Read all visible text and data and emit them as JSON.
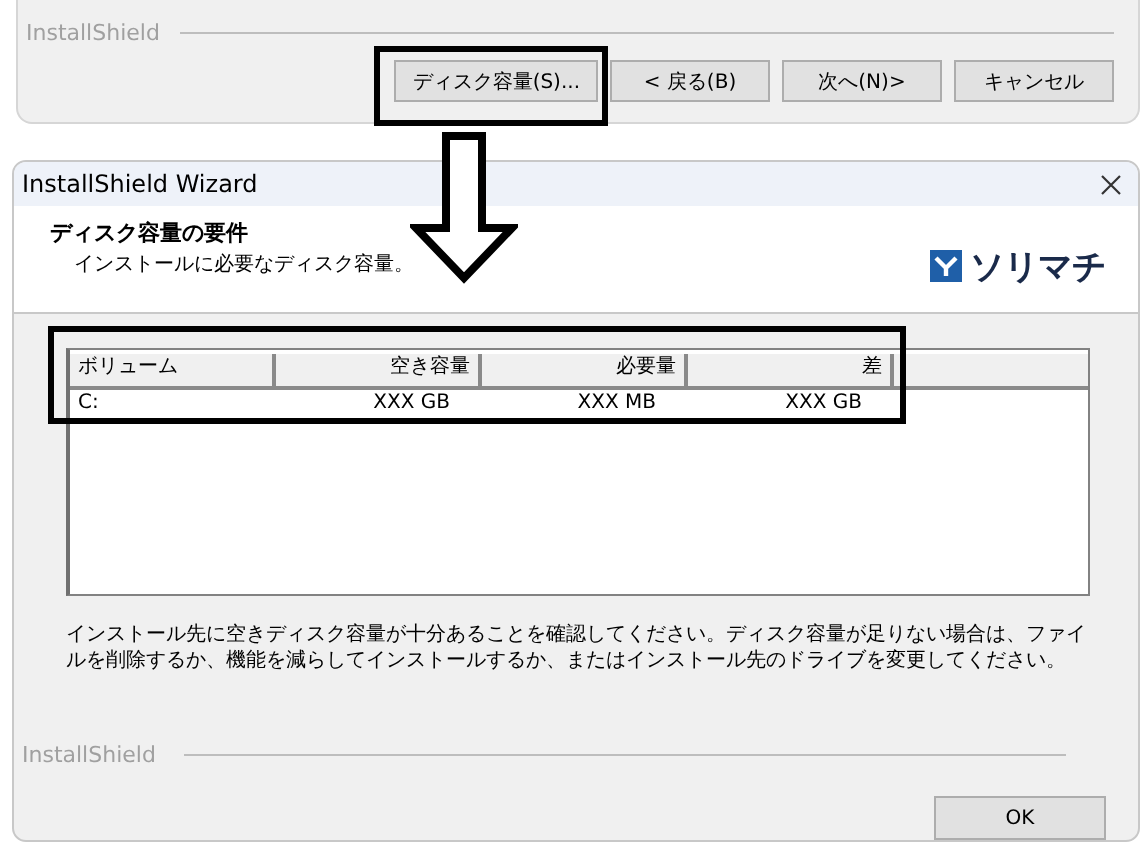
{
  "top_panel": {
    "brand": "InstallShield",
    "buttons": [
      {
        "label": "ディスク容量(S)..."
      },
      {
        "label": "< 戻る(B)"
      },
      {
        "label": "次へ(N)>"
      },
      {
        "label": "キャンセル"
      }
    ]
  },
  "dialog": {
    "title": "InstallShield Wizard",
    "header": {
      "title": "ディスク容量の要件",
      "subtitle": "インストールに必要なディスク容量。",
      "logo_text": "ソリマチ"
    },
    "table": {
      "columns": [
        {
          "label": "ボリューム"
        },
        {
          "label": "空き容量"
        },
        {
          "label": "必要量"
        },
        {
          "label": "差"
        }
      ],
      "rows": [
        [
          "C:",
          "XXX GB",
          "XXX MB",
          "XXX GB"
        ]
      ]
    },
    "message": "インストール先に空きディスク容量が十分あることを確認してください。ディスク容量が足りない場合は、ファイルを削除するか、機能を減らしてインストールするか、またはインストール先のドライブを変更してください。",
    "brand": "InstallShield",
    "buttons": [
      {
        "label": "OK"
      }
    ]
  }
}
